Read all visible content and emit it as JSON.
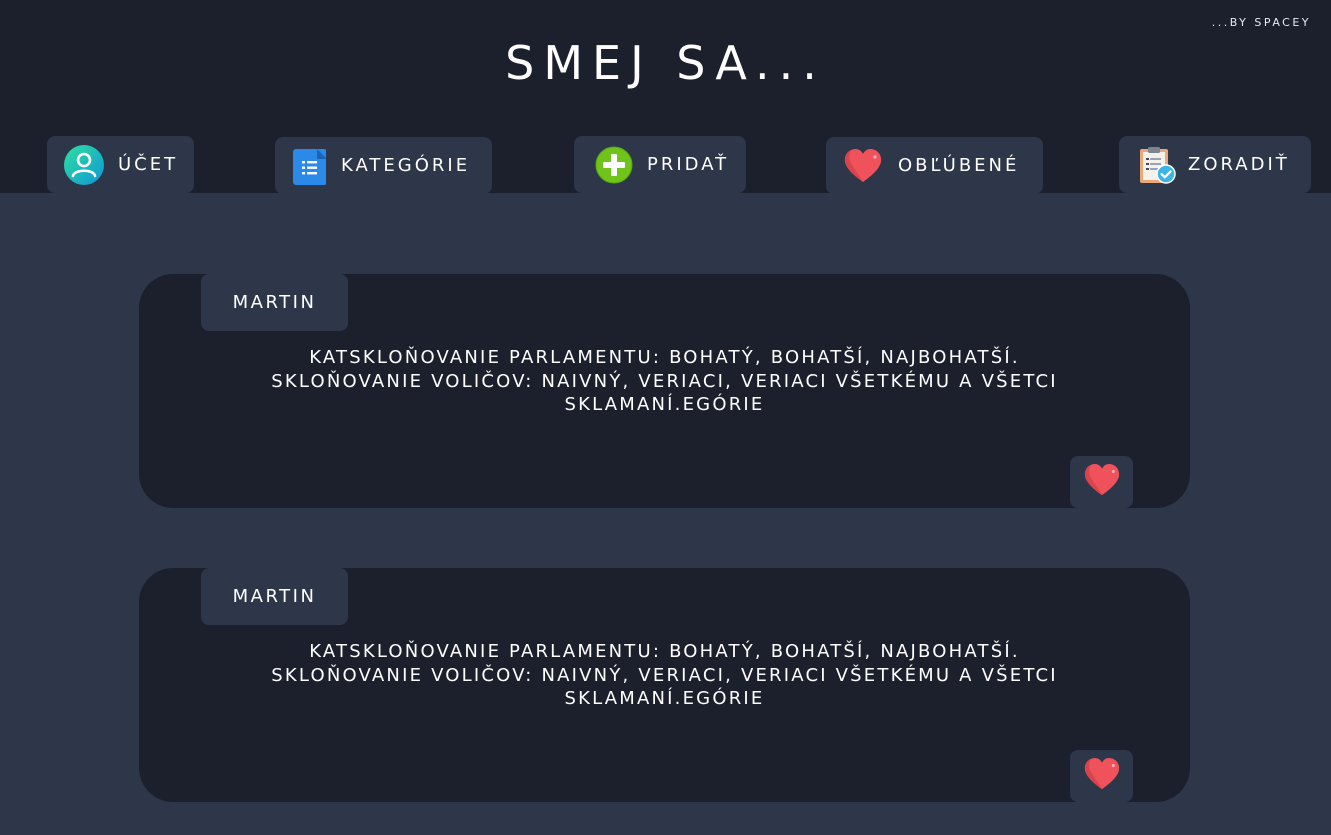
{
  "app": {
    "title": "SMEJ SA...",
    "byline": "...BY SPACEY"
  },
  "nav": [
    {
      "label": "ÚČET",
      "icon": "user-icon"
    },
    {
      "label": "KATEGÓRIE",
      "icon": "document-list-icon"
    },
    {
      "label": "PRIDAŤ",
      "icon": "plus-icon"
    },
    {
      "label": "OBĽÚBENÉ",
      "icon": "heart-icon"
    },
    {
      "label": "ZORADIŤ",
      "icon": "clipboard-check-icon"
    }
  ],
  "posts": [
    {
      "author": "MARTIN",
      "text_lines": [
        "KATSKLOŇOVANIE PARLAMENTU: BOHATÝ, BOHATŠÍ, NAJBOHATŠÍ.",
        "SKLOŇOVANIE VOLIČOV:  NAIVNÝ, VERIACI, VERIACI VŠETKÉMU A VŠETCI",
        "SKLAMANÍ.EGÓRIE"
      ],
      "favorite_icon": "heart-icon"
    },
    {
      "author": "MARTIN",
      "text_lines": [
        "KATSKLOŇOVANIE PARLAMENTU: BOHATÝ, BOHATŠÍ, NAJBOHATŠÍ.",
        "SKLOŇOVANIE VOLIČOV:  NAIVNÝ, VERIACI, VERIACI VŠETKÉMU A VŠETCI",
        "SKLAMANÍ.EGÓRIE"
      ],
      "favorite_icon": "heart-icon"
    }
  ],
  "colors": {
    "header_bg": "#1c202d",
    "page_bg": "#2e3649",
    "card_bg": "#1c202d",
    "button_bg": "#2e3649",
    "heart": "#f0525b",
    "plus": "#6fc31a",
    "user_gradient_start": "#2dd4a8",
    "user_gradient_end": "#10a0d8",
    "doc_blue": "#2b8ae8"
  }
}
